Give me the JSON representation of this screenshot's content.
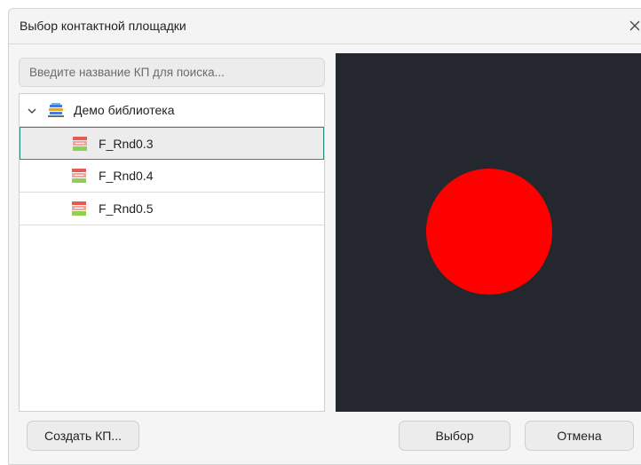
{
  "window": {
    "title": "Выбор контактной площадки"
  },
  "search": {
    "placeholder": "Введите название КП для поиска...",
    "value": ""
  },
  "tree": {
    "library": {
      "label": "Демо библиотека",
      "expanded": true,
      "icon": "library-icon"
    },
    "items": [
      {
        "label": "F_Rnd0.3",
        "selected": true,
        "icon": "footprint-icon"
      },
      {
        "label": "F_Rnd0.4",
        "selected": false,
        "icon": "footprint-icon"
      },
      {
        "label": "F_Rnd0.5",
        "selected": false,
        "icon": "footprint-icon"
      }
    ]
  },
  "preview": {
    "background_color": "#24272e",
    "pad_color": "#ff0000",
    "pad_shape": "circle"
  },
  "buttons": {
    "create": "Создать КП...",
    "select": "Выбор",
    "cancel": "Отмена"
  },
  "colors": {
    "selection_border": "#2d8a8a"
  }
}
